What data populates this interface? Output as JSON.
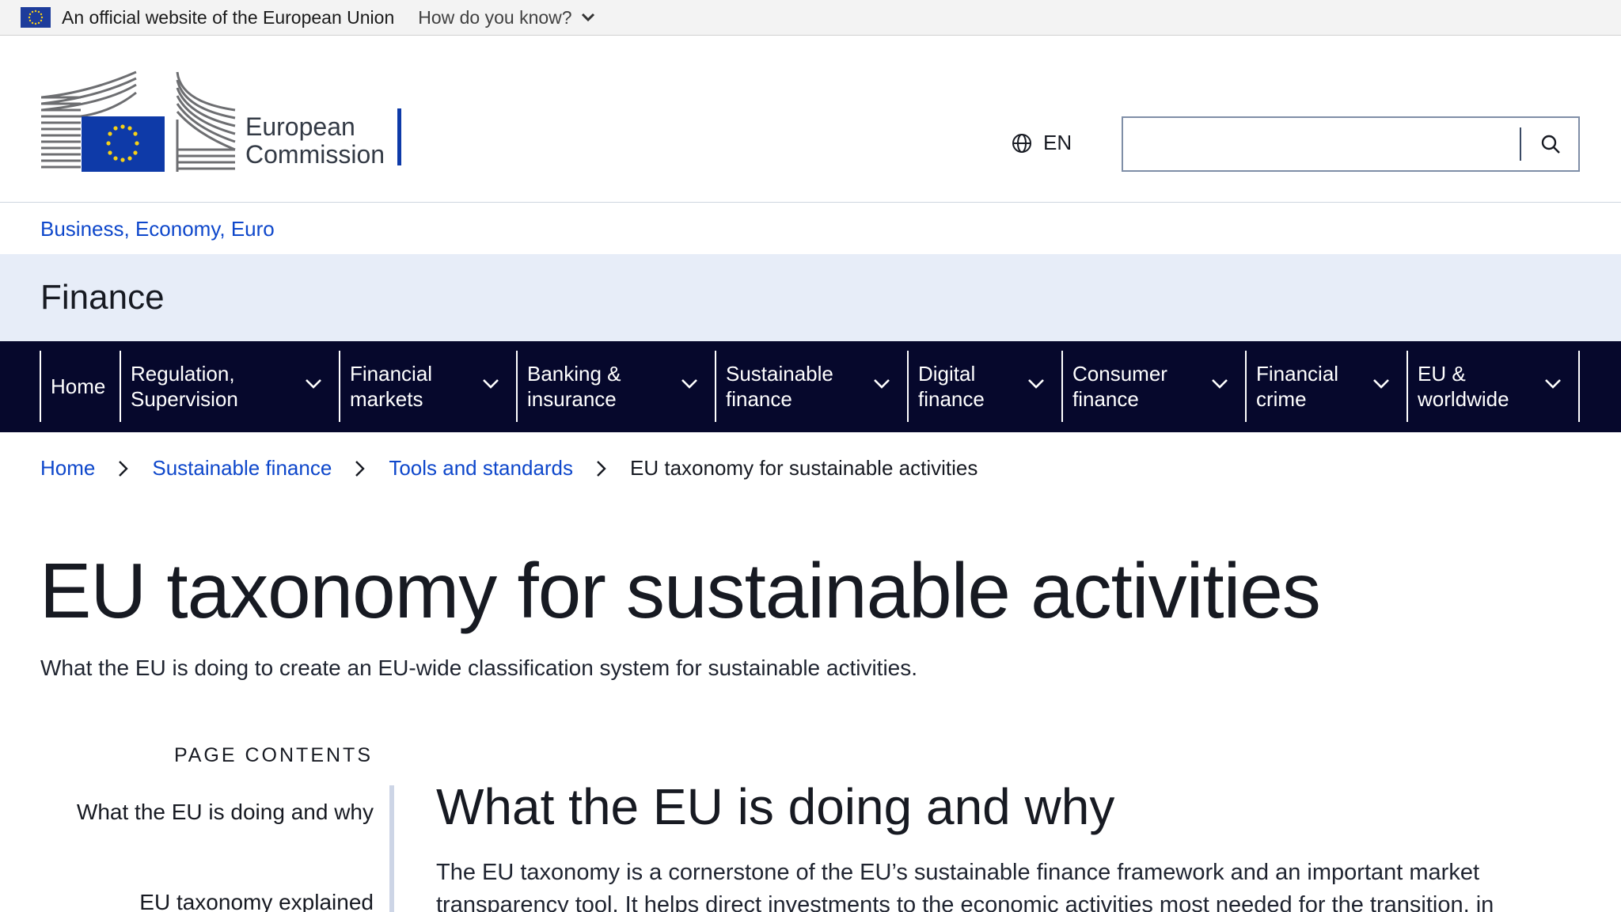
{
  "eu_banner": {
    "text": "An official website of the European Union",
    "how_label": "How do you know?"
  },
  "header": {
    "logo_line1": "European",
    "logo_line2": "Commission",
    "language": "EN",
    "search_placeholder": ""
  },
  "site": {
    "context": "Business, Economy, Euro",
    "name": "Finance"
  },
  "nav": {
    "items": [
      {
        "label": "Home"
      },
      {
        "label": "Regulation, Supervision"
      },
      {
        "label": "Financial markets"
      },
      {
        "label": "Banking & insurance"
      },
      {
        "label": "Sustainable finance"
      },
      {
        "label": "Digital finance"
      },
      {
        "label": "Consumer finance"
      },
      {
        "label": "Financial crime"
      },
      {
        "label": "EU & worldwide"
      }
    ]
  },
  "breadcrumb": {
    "items": [
      "Home",
      "Sustainable finance",
      "Tools and standards"
    ],
    "current": "EU taxonomy for sustainable activities"
  },
  "page": {
    "title": "EU taxonomy for sustainable activities",
    "intro": "What the EU is doing to create an EU-wide classification system for sustainable activities."
  },
  "toc": {
    "title": "PAGE CONTENTS",
    "items": [
      "What the EU is doing and why",
      "EU taxonomy explained"
    ]
  },
  "article": {
    "section_title": "What the EU is doing and why",
    "paragraph": "The EU taxonomy is a cornerstone of the EU’s sustainable finance framework and an important market transparency tool. It helps direct investments to the economic activities most needed for the transition, in"
  },
  "colors": {
    "nav_bg": "#06082c",
    "link": "#0e47cb",
    "band_bg": "#e7edf8",
    "logo_blue": "#0e3aa8"
  }
}
